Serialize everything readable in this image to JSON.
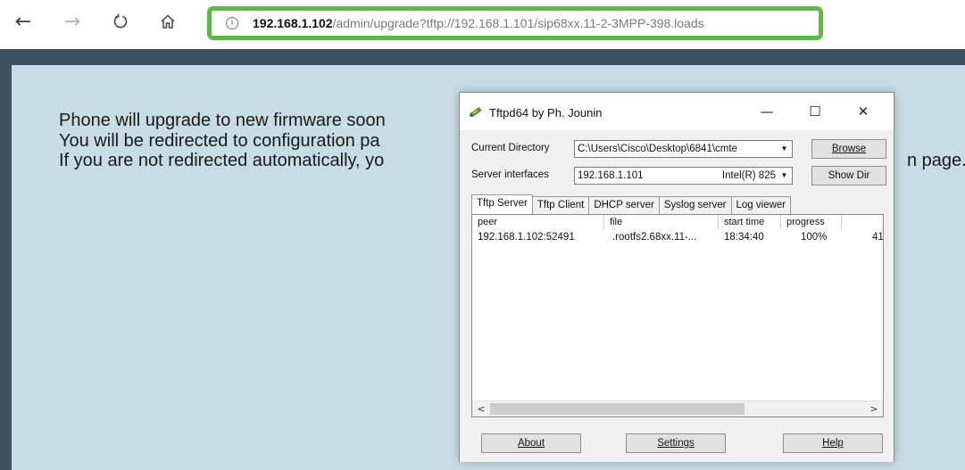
{
  "browser": {
    "back_icon": "back-arrow-icon",
    "forward_icon": "forward-arrow-icon",
    "refresh_icon": "refresh-icon",
    "home_icon": "home-icon",
    "url_host": "192.168.1.102",
    "url_path": "/admin/upgrade?tftp://192.168.1.101/sip68xx.11-2-3MPP-398.loads",
    "highlight_color": "#5cb946"
  },
  "page": {
    "lines": [
      "Phone will upgrade to new firmware soon",
      "You will be redirected to configuration pa",
      "If you are not redirected automatically, yo"
    ],
    "trailing_fragment": "n page."
  },
  "tftp_window": {
    "title": "Tftpd64 by Ph. Jounin",
    "controls": {
      "minimize": "—",
      "maximize": "☐",
      "close": "✕"
    },
    "current_directory_label": "Current Directory",
    "current_directory_value": "C:\\Users\\Cisco\\Desktop\\6841\\cmte",
    "browse_button": "Browse",
    "server_interfaces_label": "Server interfaces",
    "server_interface_ip": "192.168.1.101",
    "server_interface_adapter": "Intel(R) 825",
    "show_dir_button": "Show Dir",
    "tabs": [
      "Tftp Server",
      "Tftp Client",
      "DHCP server",
      "Syslog server",
      "Log viewer"
    ],
    "columns": [
      "peer",
      "file",
      "start time",
      "progress"
    ],
    "rows": [
      {
        "peer": "192.168.1.102:52491",
        "file": ".rootfs2.68xx.11-...",
        "start_time": "18:34:40",
        "progress": "100%",
        "extra": "41"
      }
    ],
    "footer_buttons": [
      "About",
      "Settings",
      "Help"
    ]
  }
}
